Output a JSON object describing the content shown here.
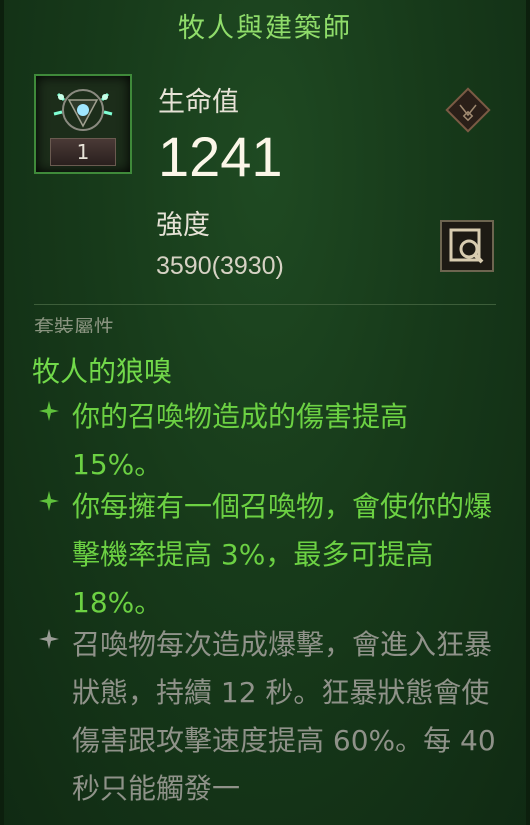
{
  "item": {
    "title": "牧人與建築師",
    "level": "1"
  },
  "stats": {
    "life_label": "生命值",
    "life_value": "1241",
    "power_label": "強度",
    "power_value": "3590(3930)"
  },
  "set": {
    "section_header": "套裝屬性",
    "name": "牧人的狼嗅",
    "bonuses": [
      {
        "text": "你的召喚物造成的傷害提高 15%。",
        "active": true
      },
      {
        "text": "你每擁有一個召喚物，會使你的爆擊機率提高 3%，最多可提高 18%。",
        "active": true
      },
      {
        "text": "召喚物每次造成爆擊，會進入狂暴狀態，持續 12 秒。狂暴狀態會使傷害跟攻擊速度提高 60%。每 40 秒只能觸發一",
        "active": false
      }
    ]
  },
  "colors": {
    "title": "#8fdc6a",
    "active_bonus": "#6cd143",
    "inactive_bonus": "#8f9289",
    "background": "#173a1a"
  },
  "icons": {
    "item": "pendant-icon",
    "slot": "diamond-amulet-icon",
    "compare": "magnifier-compare-icon",
    "bullet": "sparkle-star-icon"
  }
}
